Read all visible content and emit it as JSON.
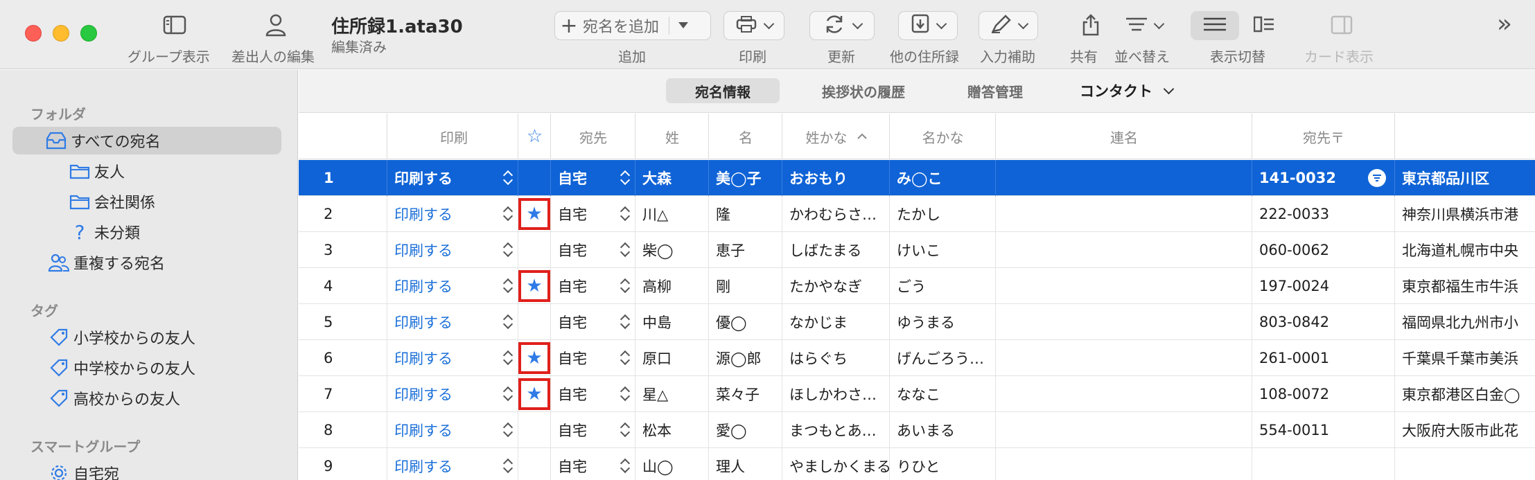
{
  "toolbar": {
    "group_view_label": "グループ表示",
    "sender_edit_label": "差出人の編集",
    "doc_title": "住所録1.ata30",
    "doc_status": "編集済み",
    "add_address_label": "宛名を追加",
    "add_label": "追加",
    "print_label": "印刷",
    "update_label": "更新",
    "other_address_label": "他の住所録",
    "input_assist_label": "入力補助",
    "share_label": "共有",
    "sort_label": "並べ替え",
    "view_switch_label": "表示切替",
    "card_view_label": "カード表示",
    "overflow_glyph": "»"
  },
  "sidebar": {
    "folder_section": "フォルダ",
    "all": "すべての宛名",
    "friends": "友人",
    "company": "会社関係",
    "uncategorized": "未分類",
    "duplicates": "重複する宛名",
    "tag_section": "タグ",
    "tag1": "小学校からの友人",
    "tag2": "中学校からの友人",
    "tag3": "高校からの友人",
    "smart_section": "スマートグループ",
    "smart1": "自宅宛"
  },
  "segments": {
    "addressee_info": "宛名情報",
    "greeting_history": "挨拶状の履歴",
    "gift_management": "贈答管理",
    "contact": "コンタクト"
  },
  "columns": {
    "print": "印刷",
    "star": "☆",
    "destination": "宛先",
    "last_name": "姓",
    "first_name": "名",
    "last_kana": "姓かな",
    "first_kana": "名かな",
    "joint_name": "連名",
    "postal": "宛先〒"
  },
  "rows": [
    {
      "no": "1",
      "print": "印刷する",
      "star": "",
      "dest": "自宅",
      "last": "大森",
      "first": "美◯子",
      "lkana": "おおもり",
      "fkana": "み◯こ",
      "postal": "141-0032",
      "addr": "東京都品川区"
    },
    {
      "no": "2",
      "print": "印刷する",
      "star": "★",
      "dest": "自宅",
      "last": "川△",
      "first": "隆",
      "lkana": "かわむらさ…",
      "fkana": "たかし",
      "postal": "222-0033",
      "addr": "神奈川県横浜市港"
    },
    {
      "no": "3",
      "print": "印刷する",
      "star": "",
      "dest": "自宅",
      "last": "柴◯",
      "first": "恵子",
      "lkana": "しばたまる",
      "fkana": "けいこ",
      "postal": "060-0062",
      "addr": "北海道札幌市中央"
    },
    {
      "no": "4",
      "print": "印刷する",
      "star": "★",
      "dest": "自宅",
      "last": "高柳",
      "first": "剛",
      "lkana": "たかやなぎ",
      "fkana": "ごう",
      "postal": "197-0024",
      "addr": "東京都福生市牛浜"
    },
    {
      "no": "5",
      "print": "印刷する",
      "star": "",
      "dest": "自宅",
      "last": "中島",
      "first": "優◯",
      "lkana": "なかじま",
      "fkana": "ゆうまる",
      "postal": "803-0842",
      "addr": "福岡県北九州市小"
    },
    {
      "no": "6",
      "print": "印刷する",
      "star": "★",
      "dest": "自宅",
      "last": "原口",
      "first": "源◯郎",
      "lkana": "はらぐち",
      "fkana": "げんごろう…",
      "postal": "261-0001",
      "addr": "千葉県千葉市美浜"
    },
    {
      "no": "7",
      "print": "印刷する",
      "star": "★",
      "dest": "自宅",
      "last": "星△",
      "first": "菜々子",
      "lkana": "ほしかわさ…",
      "fkana": "ななこ",
      "postal": "108-0072",
      "addr": "東京都港区白金◯"
    },
    {
      "no": "8",
      "print": "印刷する",
      "star": "",
      "dest": "自宅",
      "last": "松本",
      "first": "愛◯",
      "lkana": "まつもとあ…",
      "fkana": "あいまる",
      "postal": "554-0011",
      "addr": "大阪府大阪市此花"
    },
    {
      "no": "9",
      "print": "印刷する",
      "star": "",
      "dest": "自宅",
      "last": "山◯",
      "first": "理人",
      "lkana": "やましかくまる",
      "fkana": "りひと",
      "postal": "",
      "addr": ""
    }
  ]
}
